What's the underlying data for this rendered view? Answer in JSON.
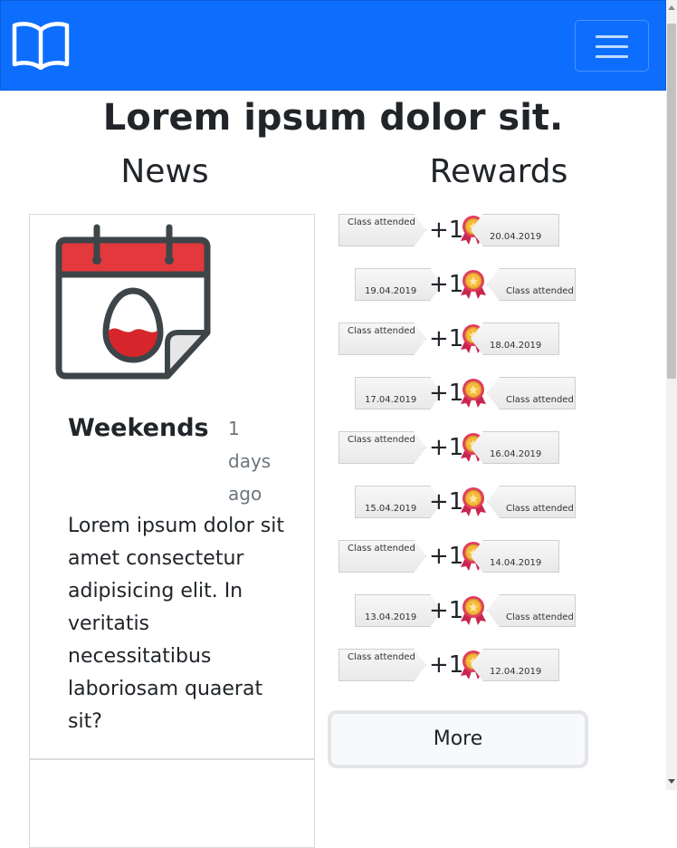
{
  "navbar": {
    "logo_icon": "open-book-icon",
    "menu_icon": "hamburger-icon",
    "color": "#0d6efd"
  },
  "page": {
    "title": "Lorem ipsum dolor sit."
  },
  "news": {
    "heading": "News",
    "items": [
      {
        "icon": "calendar-easter-egg-icon",
        "title": "Weekends",
        "time": "1 days ago",
        "body": "Lorem ipsum dolor sit amet consectetur adipisicing elit. In veritatis necessitatibus laboriosam quaerat sit?"
      }
    ]
  },
  "rewards": {
    "heading": "Rewards",
    "points": "+1",
    "label": "Class attended",
    "items": [
      {
        "date": "20.04.2019"
      },
      {
        "date": "19.04.2019"
      },
      {
        "date": "18.04.2019"
      },
      {
        "date": "17.04.2019"
      },
      {
        "date": "16.04.2019"
      },
      {
        "date": "15.04.2019"
      },
      {
        "date": "14.04.2019"
      },
      {
        "date": "13.04.2019"
      },
      {
        "date": "12.04.2019"
      }
    ],
    "more_label": "More"
  }
}
